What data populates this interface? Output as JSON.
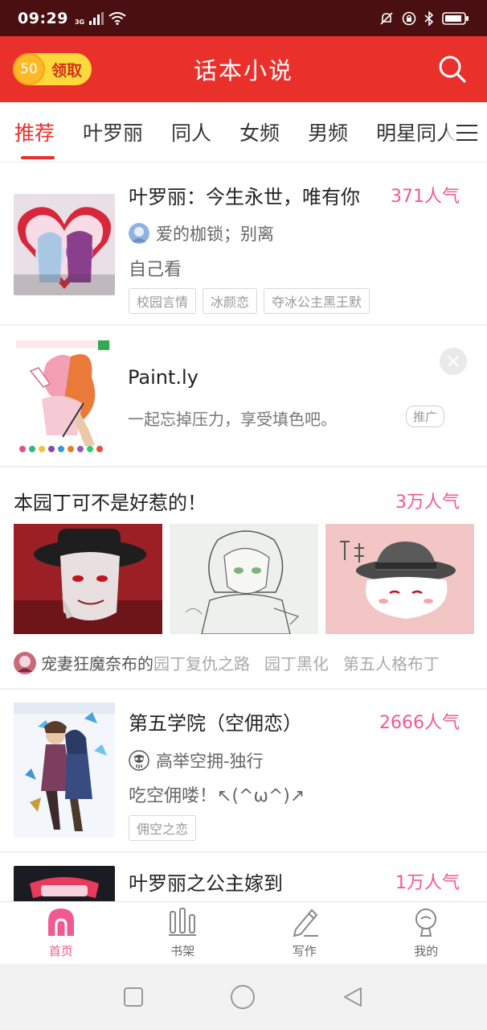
{
  "status": {
    "time": "09:29",
    "network": "3G"
  },
  "header": {
    "coin_value": "50",
    "coin_label": "领取",
    "title": "话本小说"
  },
  "tabs": [
    {
      "label": "推荐"
    },
    {
      "label": "叶罗丽"
    },
    {
      "label": "同人"
    },
    {
      "label": "女频"
    },
    {
      "label": "男频"
    },
    {
      "label": "明星同人"
    }
  ],
  "feed": {
    "story1": {
      "title": "叶罗丽：今生永世，唯有你",
      "popularity": "371人气",
      "author": "爱的枷锁；别离",
      "description": "自己看",
      "tags": [
        "校园言情",
        "冰颜恋",
        "夺冰公主黑王默"
      ]
    },
    "ad": {
      "title": "Paint.ly",
      "description": "一起忘掉压力，享受填色吧。",
      "badge": "推广"
    },
    "topic": {
      "title": "本园丁可不是好惹的！",
      "popularity": "3万人气",
      "links": [
        "宠妻狂魔奈布的",
        "园丁复仇之路",
        "园丁黑化",
        "第五人格布丁"
      ]
    },
    "story2": {
      "title": "第五学院（空佣恋）",
      "popularity": "2666人气",
      "author": "高举空拥-独行",
      "description": "吃空佣喽！↖(^ω^)↗",
      "tags": [
        "佣空之恋"
      ]
    },
    "story3": {
      "title": "叶罗丽之公主嫁到",
      "popularity": "1万人气"
    }
  },
  "bottom_nav": [
    {
      "label": "首页",
      "icon": "home-icon",
      "active": true
    },
    {
      "label": "书架",
      "icon": "bookshelf-icon"
    },
    {
      "label": "写作",
      "icon": "pencil-icon"
    },
    {
      "label": "我的",
      "icon": "profile-icon"
    }
  ],
  "colors": {
    "header": "#e9302b",
    "accent_pink": "#f05a92",
    "status_bar": "#4a0f10"
  }
}
